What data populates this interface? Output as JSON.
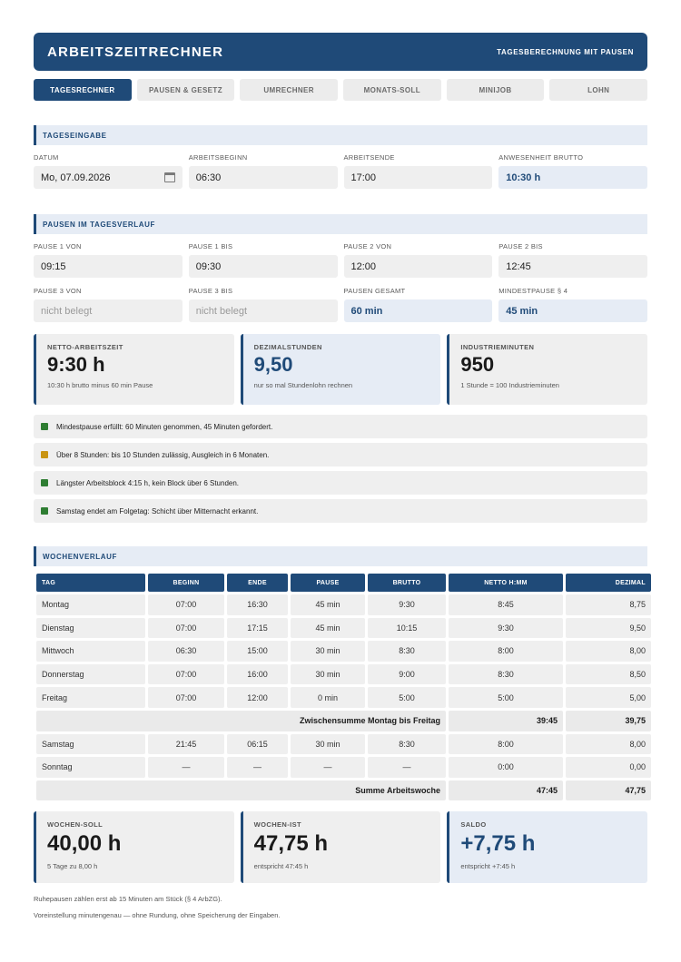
{
  "header": {
    "title": "ARBEITSZEITRECHNER",
    "subtitle": "TAGESBERECHNUNG MIT PAUSEN"
  },
  "tabs": [
    {
      "label": "TAGESRECHNER",
      "active": true
    },
    {
      "label": "PAUSEN & GESETZ"
    },
    {
      "label": "UMRECHNER"
    },
    {
      "label": "MONATS-SOLL"
    },
    {
      "label": "MINIJOB"
    },
    {
      "label": "LOHN"
    }
  ],
  "tageseingabe": {
    "heading": "TAGESEINGABE",
    "datum": {
      "label": "DATUM",
      "value": "Mo, 07.09.2026"
    },
    "beginn": {
      "label": "ARBEITSBEGINN",
      "value": "06:30"
    },
    "ende": {
      "label": "ARBEITSENDE",
      "value": "17:00"
    },
    "brutto": {
      "label": "ANWESENHEIT BRUTTO",
      "value": "10:30 h"
    }
  },
  "pausen": {
    "heading": "PAUSEN IM TAGESVERLAUF",
    "p1von": {
      "label": "PAUSE 1 VON",
      "value": "09:15"
    },
    "p1bis": {
      "label": "PAUSE 1 BIS",
      "value": "09:30"
    },
    "p2von": {
      "label": "PAUSE 2 VON",
      "value": "12:00"
    },
    "p2bis": {
      "label": "PAUSE 2 BIS",
      "value": "12:45"
    },
    "p3von": {
      "label": "PAUSE 3 VON",
      "placeholder": "nicht belegt"
    },
    "p3bis": {
      "label": "PAUSE 3 BIS",
      "placeholder": "nicht belegt"
    },
    "gesamt": {
      "label": "PAUSEN GESAMT",
      "value": "60 min"
    },
    "mindest": {
      "label": "MINDESTPAUSE § 4",
      "value": "45 min"
    }
  },
  "results": {
    "netto": {
      "label": "NETTO-ARBEITSZEIT",
      "value": "9:30 h",
      "note": "10:30 h brutto minus 60 min Pause"
    },
    "dezimal": {
      "label": "DEZIMALSTUNDEN",
      "value": "9,50",
      "note": "nur so mal Stundenlohn rechnen"
    },
    "industrie": {
      "label": "INDUSTRIEMINUTEN",
      "value": "950",
      "note": "1 Stunde = 100 Industrieminuten"
    }
  },
  "notes": [
    {
      "text": "Mindestpause erfüllt: 60 Minuten genommen, 45 Minuten gefordert.",
      "color": "#2e7d32"
    },
    {
      "text": "Über 8 Stunden: bis 10 Stunden zulässig, Ausgleich in 6 Monaten.",
      "color": "#c99412"
    },
    {
      "text": "Längster Arbeitsblock 4:15 h, kein Block über 6 Stunden.",
      "color": "#2e7d32"
    },
    {
      "text": "Samstag endet am Folgetag: Schicht über Mitternacht erkannt.",
      "color": "#2e7d32"
    }
  ],
  "woche": {
    "heading": "WOCHENVERLAUF",
    "columns": [
      "TAG",
      "BEGINN",
      "ENDE",
      "PAUSE",
      "BRUTTO",
      "NETTO H:MM",
      "DEZIMAL"
    ],
    "rows": [
      [
        "Montag",
        "07:00",
        "16:30",
        "45 min",
        "9:30",
        "8:45",
        "8,75"
      ],
      [
        "Dienstag",
        "07:00",
        "17:15",
        "45 min",
        "10:15",
        "9:30",
        "9,50"
      ],
      [
        "Mittwoch",
        "06:30",
        "15:00",
        "30 min",
        "8:30",
        "8:00",
        "8,00"
      ],
      [
        "Donnerstag",
        "07:00",
        "16:00",
        "30 min",
        "9:00",
        "8:30",
        "8,50"
      ],
      [
        "Freitag",
        "07:00",
        "12:00",
        "0 min",
        "5:00",
        "5:00",
        "5,00"
      ]
    ],
    "subtotal": {
      "label": "Zwischensumme Montag bis Freitag",
      "netto": "39:45",
      "dezimal": "39,75"
    },
    "weekend": [
      [
        "Samstag",
        "21:45",
        "06:15",
        "30 min",
        "8:30",
        "8:00",
        "8,00"
      ],
      [
        "Sonntag",
        "—",
        "—",
        "—",
        "—",
        "0:00",
        "0,00"
      ]
    ],
    "total": {
      "label": "Summe Arbeitswoche",
      "netto": "47:45",
      "dezimal": "47,75"
    }
  },
  "summary": {
    "soll": {
      "label": "WOCHEN-SOLL",
      "value": "40,00 h",
      "note": "5 Tage zu 8,00 h"
    },
    "ist": {
      "label": "WOCHEN-IST",
      "value": "47,75 h",
      "note": "entspricht 47:45 h"
    },
    "saldo": {
      "label": "SALDO",
      "value": "+7,75 h",
      "note": "entspricht +7:45 h"
    }
  },
  "footer": {
    "line1": "Ruhepausen zählen erst ab 15 Minuten am Stück (§ 4 ArbZG).",
    "line2": "Voreinstellung minutengenau — ohne Rundung, ohne Speicherung der Eingaben."
  }
}
